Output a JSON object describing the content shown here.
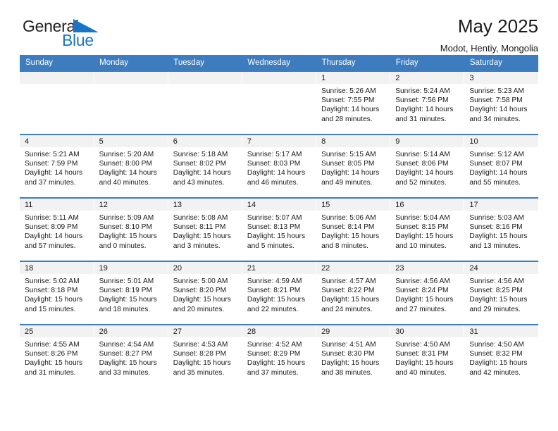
{
  "brand": {
    "name_top": "General",
    "name_bottom": "Blue",
    "mark": "triangle-sail-icon",
    "color_blue": "#1a76c4",
    "color_dark": "#231f20"
  },
  "header": {
    "title": "May 2025",
    "subtitle": "Modot, Hentiy, Mongolia"
  },
  "theme": {
    "header_row_bg": "#3c7cbf",
    "day_band_bg": "#f2f2f2",
    "row_rule": "#3c7cbf"
  },
  "weekday_headers": [
    "Sunday",
    "Monday",
    "Tuesday",
    "Wednesday",
    "Thursday",
    "Friday",
    "Saturday"
  ],
  "weeks": [
    [
      {
        "day": "",
        "sunrise": "",
        "sunset": "",
        "daylight_1": "",
        "daylight_2": ""
      },
      {
        "day": "",
        "sunrise": "",
        "sunset": "",
        "daylight_1": "",
        "daylight_2": ""
      },
      {
        "day": "",
        "sunrise": "",
        "sunset": "",
        "daylight_1": "",
        "daylight_2": ""
      },
      {
        "day": "",
        "sunrise": "",
        "sunset": "",
        "daylight_1": "",
        "daylight_2": ""
      },
      {
        "day": "1",
        "sunrise": "Sunrise: 5:26 AM",
        "sunset": "Sunset: 7:55 PM",
        "daylight_1": "Daylight: 14 hours",
        "daylight_2": "and 28 minutes."
      },
      {
        "day": "2",
        "sunrise": "Sunrise: 5:24 AM",
        "sunset": "Sunset: 7:56 PM",
        "daylight_1": "Daylight: 14 hours",
        "daylight_2": "and 31 minutes."
      },
      {
        "day": "3",
        "sunrise": "Sunrise: 5:23 AM",
        "sunset": "Sunset: 7:58 PM",
        "daylight_1": "Daylight: 14 hours",
        "daylight_2": "and 34 minutes."
      }
    ],
    [
      {
        "day": "4",
        "sunrise": "Sunrise: 5:21 AM",
        "sunset": "Sunset: 7:59 PM",
        "daylight_1": "Daylight: 14 hours",
        "daylight_2": "and 37 minutes."
      },
      {
        "day": "5",
        "sunrise": "Sunrise: 5:20 AM",
        "sunset": "Sunset: 8:00 PM",
        "daylight_1": "Daylight: 14 hours",
        "daylight_2": "and 40 minutes."
      },
      {
        "day": "6",
        "sunrise": "Sunrise: 5:18 AM",
        "sunset": "Sunset: 8:02 PM",
        "daylight_1": "Daylight: 14 hours",
        "daylight_2": "and 43 minutes."
      },
      {
        "day": "7",
        "sunrise": "Sunrise: 5:17 AM",
        "sunset": "Sunset: 8:03 PM",
        "daylight_1": "Daylight: 14 hours",
        "daylight_2": "and 46 minutes."
      },
      {
        "day": "8",
        "sunrise": "Sunrise: 5:15 AM",
        "sunset": "Sunset: 8:05 PM",
        "daylight_1": "Daylight: 14 hours",
        "daylight_2": "and 49 minutes."
      },
      {
        "day": "9",
        "sunrise": "Sunrise: 5:14 AM",
        "sunset": "Sunset: 8:06 PM",
        "daylight_1": "Daylight: 14 hours",
        "daylight_2": "and 52 minutes."
      },
      {
        "day": "10",
        "sunrise": "Sunrise: 5:12 AM",
        "sunset": "Sunset: 8:07 PM",
        "daylight_1": "Daylight: 14 hours",
        "daylight_2": "and 55 minutes."
      }
    ],
    [
      {
        "day": "11",
        "sunrise": "Sunrise: 5:11 AM",
        "sunset": "Sunset: 8:09 PM",
        "daylight_1": "Daylight: 14 hours",
        "daylight_2": "and 57 minutes."
      },
      {
        "day": "12",
        "sunrise": "Sunrise: 5:09 AM",
        "sunset": "Sunset: 8:10 PM",
        "daylight_1": "Daylight: 15 hours",
        "daylight_2": "and 0 minutes."
      },
      {
        "day": "13",
        "sunrise": "Sunrise: 5:08 AM",
        "sunset": "Sunset: 8:11 PM",
        "daylight_1": "Daylight: 15 hours",
        "daylight_2": "and 3 minutes."
      },
      {
        "day": "14",
        "sunrise": "Sunrise: 5:07 AM",
        "sunset": "Sunset: 8:13 PM",
        "daylight_1": "Daylight: 15 hours",
        "daylight_2": "and 5 minutes."
      },
      {
        "day": "15",
        "sunrise": "Sunrise: 5:06 AM",
        "sunset": "Sunset: 8:14 PM",
        "daylight_1": "Daylight: 15 hours",
        "daylight_2": "and 8 minutes."
      },
      {
        "day": "16",
        "sunrise": "Sunrise: 5:04 AM",
        "sunset": "Sunset: 8:15 PM",
        "daylight_1": "Daylight: 15 hours",
        "daylight_2": "and 10 minutes."
      },
      {
        "day": "17",
        "sunrise": "Sunrise: 5:03 AM",
        "sunset": "Sunset: 8:16 PM",
        "daylight_1": "Daylight: 15 hours",
        "daylight_2": "and 13 minutes."
      }
    ],
    [
      {
        "day": "18",
        "sunrise": "Sunrise: 5:02 AM",
        "sunset": "Sunset: 8:18 PM",
        "daylight_1": "Daylight: 15 hours",
        "daylight_2": "and 15 minutes."
      },
      {
        "day": "19",
        "sunrise": "Sunrise: 5:01 AM",
        "sunset": "Sunset: 8:19 PM",
        "daylight_1": "Daylight: 15 hours",
        "daylight_2": "and 18 minutes."
      },
      {
        "day": "20",
        "sunrise": "Sunrise: 5:00 AM",
        "sunset": "Sunset: 8:20 PM",
        "daylight_1": "Daylight: 15 hours",
        "daylight_2": "and 20 minutes."
      },
      {
        "day": "21",
        "sunrise": "Sunrise: 4:59 AM",
        "sunset": "Sunset: 8:21 PM",
        "daylight_1": "Daylight: 15 hours",
        "daylight_2": "and 22 minutes."
      },
      {
        "day": "22",
        "sunrise": "Sunrise: 4:57 AM",
        "sunset": "Sunset: 8:22 PM",
        "daylight_1": "Daylight: 15 hours",
        "daylight_2": "and 24 minutes."
      },
      {
        "day": "23",
        "sunrise": "Sunrise: 4:56 AM",
        "sunset": "Sunset: 8:24 PM",
        "daylight_1": "Daylight: 15 hours",
        "daylight_2": "and 27 minutes."
      },
      {
        "day": "24",
        "sunrise": "Sunrise: 4:56 AM",
        "sunset": "Sunset: 8:25 PM",
        "daylight_1": "Daylight: 15 hours",
        "daylight_2": "and 29 minutes."
      }
    ],
    [
      {
        "day": "25",
        "sunrise": "Sunrise: 4:55 AM",
        "sunset": "Sunset: 8:26 PM",
        "daylight_1": "Daylight: 15 hours",
        "daylight_2": "and 31 minutes."
      },
      {
        "day": "26",
        "sunrise": "Sunrise: 4:54 AM",
        "sunset": "Sunset: 8:27 PM",
        "daylight_1": "Daylight: 15 hours",
        "daylight_2": "and 33 minutes."
      },
      {
        "day": "27",
        "sunrise": "Sunrise: 4:53 AM",
        "sunset": "Sunset: 8:28 PM",
        "daylight_1": "Daylight: 15 hours",
        "daylight_2": "and 35 minutes."
      },
      {
        "day": "28",
        "sunrise": "Sunrise: 4:52 AM",
        "sunset": "Sunset: 8:29 PM",
        "daylight_1": "Daylight: 15 hours",
        "daylight_2": "and 37 minutes."
      },
      {
        "day": "29",
        "sunrise": "Sunrise: 4:51 AM",
        "sunset": "Sunset: 8:30 PM",
        "daylight_1": "Daylight: 15 hours",
        "daylight_2": "and 38 minutes."
      },
      {
        "day": "30",
        "sunrise": "Sunrise: 4:50 AM",
        "sunset": "Sunset: 8:31 PM",
        "daylight_1": "Daylight: 15 hours",
        "daylight_2": "and 40 minutes."
      },
      {
        "day": "31",
        "sunrise": "Sunrise: 4:50 AM",
        "sunset": "Sunset: 8:32 PM",
        "daylight_1": "Daylight: 15 hours",
        "daylight_2": "and 42 minutes."
      }
    ]
  ]
}
